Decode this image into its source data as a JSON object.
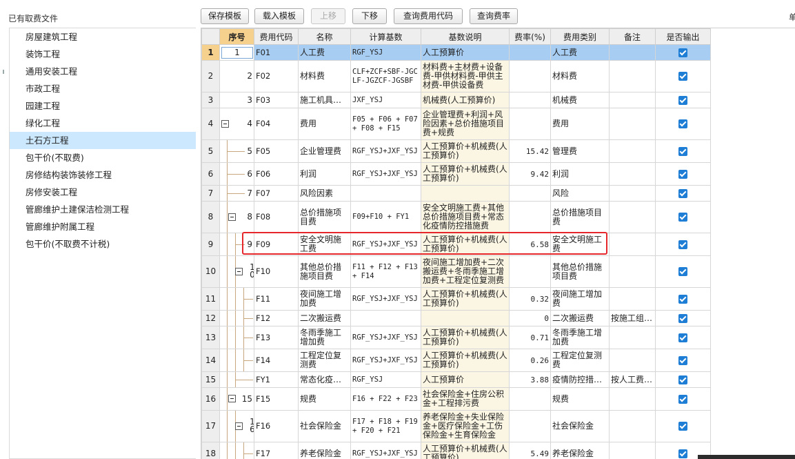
{
  "left": {
    "title": "已有取费文件",
    "items": [
      {
        "label": "房屋建筑工程",
        "selected": false
      },
      {
        "label": "装饰工程",
        "selected": false
      },
      {
        "label": "通用安装工程",
        "selected": false
      },
      {
        "label": "市政工程",
        "selected": false
      },
      {
        "label": "园建工程",
        "selected": false
      },
      {
        "label": "绿化工程",
        "selected": false
      },
      {
        "label": "土石方工程",
        "selected": true
      },
      {
        "label": "包干价(不取费)",
        "selected": false
      },
      {
        "label": "房修结构装饰装修工程",
        "selected": false
      },
      {
        "label": "房修安装工程",
        "selected": false
      },
      {
        "label": "管廊维护土建保洁检测工程",
        "selected": false
      },
      {
        "label": "管廊维护附属工程",
        "selected": false
      },
      {
        "label": "包干价(不取费不计税)",
        "selected": false
      }
    ]
  },
  "toolbar": {
    "save_template": "保存模板",
    "load_template": "载入模板",
    "move_up": "上移",
    "move_down": "下移",
    "query_code": "查询费用代码",
    "query_rate": "查询费率",
    "right_char": "单"
  },
  "table": {
    "headers": [
      "序号",
      "费用代码",
      "名称",
      "计算基数",
      "基数说明",
      "费率(%)",
      "费用类别",
      "备注",
      "是否输出"
    ],
    "rows": [
      {
        "n": "1",
        "seq": "1",
        "code": "F01",
        "name": "人工费",
        "base": "RGF_YSJ",
        "desc": "人工预算价",
        "rate": "",
        "cat": "人工费",
        "note": "",
        "out": true
      },
      {
        "n": "2",
        "seq": "2",
        "code": "F02",
        "name": "材料费",
        "base": "CLF+ZCF+SBF-JGCLF-JGZCF-JGSBF",
        "desc": "材料费+主材费+设备费-甲供材料费-甲供主材费-甲供设备费",
        "rate": "",
        "cat": "材料费",
        "note": "",
        "out": true
      },
      {
        "n": "3",
        "seq": "3",
        "code": "F03",
        "name": "施工机具…",
        "base": "JXF_YSJ",
        "desc": "机械费(人工预算价)",
        "rate": "",
        "cat": "机械费",
        "note": "",
        "out": true
      },
      {
        "n": "4",
        "seq": "4",
        "code": "F04",
        "name": "费用",
        "base": "F05 + F06 + F07 + F08 + F15",
        "desc": "企业管理费+利润+风险因素+总价措施项目费+规费",
        "rate": "",
        "cat": "费用",
        "note": "",
        "out": true
      },
      {
        "n": "5",
        "seq": "5",
        "code": "F05",
        "name": "企业管理费",
        "base": "RGF_YSJ+JXF_YSJ",
        "desc": "人工预算价+机械费(人工预算价)",
        "rate": "15.42",
        "cat": "管理费",
        "note": "",
        "out": true
      },
      {
        "n": "6",
        "seq": "6",
        "code": "F06",
        "name": "利润",
        "base": "RGF_YSJ+JXF_YSJ",
        "desc": "人工预算价+机械费(人工预算价)",
        "rate": "9.42",
        "cat": "利润",
        "note": "",
        "out": true
      },
      {
        "n": "7",
        "seq": "7",
        "code": "F07",
        "name": "风险因素",
        "base": "",
        "desc": "",
        "rate": "",
        "cat": "风险",
        "note": "",
        "out": true
      },
      {
        "n": "8",
        "seq": "8",
        "code": "F08",
        "name": "总价措施项目费",
        "base": "F09+F10 + FY1",
        "desc": "安全文明施工费+其他总价措施项目费+常态化疫情防控措施费",
        "rate": "",
        "cat": "总价措施项目费",
        "note": "",
        "out": true
      },
      {
        "n": "9",
        "seq": "9",
        "code": "F09",
        "name": "安全文明施工费",
        "base": "RGF_YSJ+JXF_YSJ",
        "desc": "人工预算价+机械费(人工预算价)",
        "rate": "6.58",
        "cat": "安全文明施工费",
        "note": "",
        "out": true
      },
      {
        "n": "10",
        "seq": "10",
        "code": "F10",
        "name": "其他总价措施项目费",
        "base": "F11 + F12 + F13 + F14",
        "desc": "夜间施工增加费+二次搬运费+冬雨季施工增加费+工程定位复测费",
        "rate": "",
        "cat": "其他总价措施项目费",
        "note": "",
        "out": true
      },
      {
        "n": "11",
        "seq": "",
        "code": "F11",
        "name": "夜间施工增加费",
        "base": "RGF_YSJ+JXF_YSJ",
        "desc": "人工预算价+机械费(人工预算价)",
        "rate": "0.32",
        "cat": "夜间施工增加费",
        "note": "",
        "out": true
      },
      {
        "n": "12",
        "seq": "",
        "code": "F12",
        "name": "二次搬运费",
        "base": "",
        "desc": "",
        "rate": "0",
        "cat": "二次搬运费",
        "note": "按施工组…",
        "out": true
      },
      {
        "n": "13",
        "seq": "",
        "code": "F13",
        "name": "冬雨季施工增加费",
        "base": "RGF_YSJ+JXF_YSJ",
        "desc": "人工预算价+机械费(人工预算价)",
        "rate": "0.71",
        "cat": "冬雨季施工增加费",
        "note": "",
        "out": true
      },
      {
        "n": "14",
        "seq": "",
        "code": "F14",
        "name": "工程定位复测费",
        "base": "RGF_YSJ+JXF_YSJ",
        "desc": "人工预算价+机械费(人工预算价)",
        "rate": "0.26",
        "cat": "工程定位复测费",
        "note": "",
        "out": true
      },
      {
        "n": "15",
        "seq": "",
        "code": "FY1",
        "name": "常态化疫…",
        "base": "RGF_YSJ",
        "desc": "人工预算价",
        "rate": "3.88",
        "cat": "疫情防控措…",
        "note": "按人工费…",
        "out": true
      },
      {
        "n": "16",
        "seq": "15",
        "code": "F15",
        "name": "规费",
        "base": "F16 + F22 + F23",
        "desc": "社会保险金+住房公积金+工程排污费",
        "rate": "",
        "cat": "规费",
        "note": "",
        "out": true
      },
      {
        "n": "17",
        "seq": "16",
        "code": "F16",
        "name": "社会保险金",
        "base": "F17 + F18 + F19 + F20 + F21",
        "desc": "养老保险金+失业保险金+医疗保险金+工伤保险金+生育保险金",
        "rate": "",
        "cat": "社会保险金",
        "note": "",
        "out": true
      },
      {
        "n": "18",
        "seq": "",
        "code": "F17",
        "name": "养老保险金",
        "base": "RGF_YSJ+JXF_YSJ",
        "desc": "人工预算价+机械费(人工预算价)",
        "rate": "5.49",
        "cat": "养老保险金",
        "note": "",
        "out": true
      }
    ]
  }
}
